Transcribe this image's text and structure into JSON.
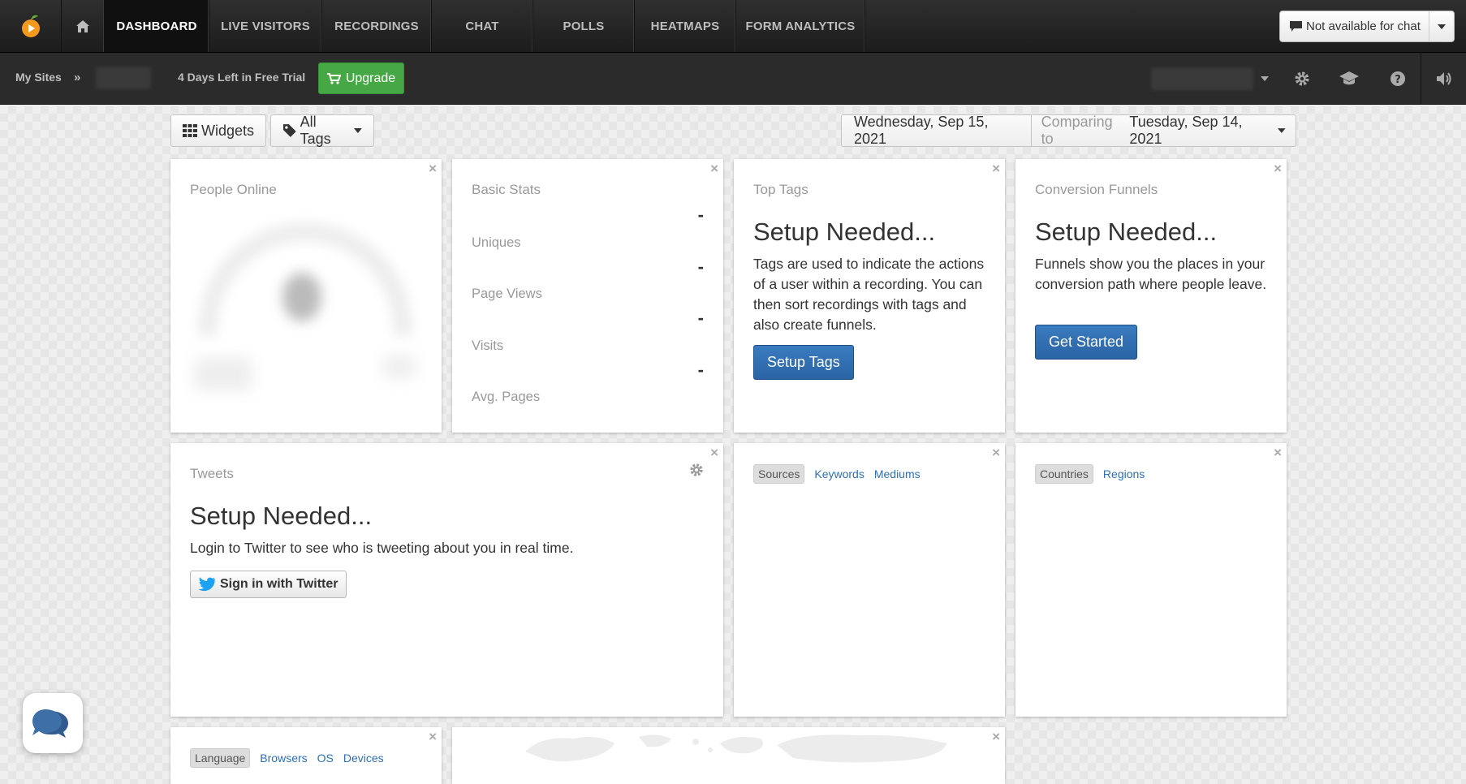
{
  "nav": {
    "items": [
      {
        "label": "DASHBOARD",
        "active": true
      },
      {
        "label": "LIVE VISITORS",
        "active": false
      },
      {
        "label": "RECORDINGS",
        "active": false
      },
      {
        "label": "CHAT",
        "active": false
      },
      {
        "label": "POLLS",
        "active": false
      },
      {
        "label": "HEATMAPS",
        "active": false
      },
      {
        "label": "FORM ANALYTICS",
        "active": false
      }
    ],
    "chat_status": "Not available for chat"
  },
  "subnav": {
    "my_sites": "My Sites",
    "separator": "»",
    "trial": "4 Days Left in Free Trial",
    "upgrade": "Upgrade"
  },
  "toolbar": {
    "widgets": "Widgets",
    "all_tags": "All Tags",
    "date": "Wednesday, Sep 15, 2021",
    "comparing_prefix": "Comparing to",
    "comparing_date": "Tuesday, Sep 14, 2021"
  },
  "widgets": {
    "close_glyph": "×",
    "people_online": {
      "title": "People Online"
    },
    "basic_stats": {
      "title": "Basic Stats",
      "stats": [
        {
          "label": "Uniques",
          "value": "-"
        },
        {
          "label": "Page Views",
          "value": "-"
        },
        {
          "label": "Visits",
          "value": "-"
        },
        {
          "label": "Avg. Pages",
          "value": "-"
        }
      ]
    },
    "top_tags": {
      "title": "Top Tags",
      "heading": "Setup Needed...",
      "desc": "Tags are used to indicate the actions of a user within a recording. You can then sort recordings with tags and also create funnels.",
      "button": "Setup Tags"
    },
    "conversion_funnels": {
      "title": "Conversion Funnels",
      "heading": "Setup Needed...",
      "desc": "Funnels show you the places in your conversion path where people leave.",
      "button": "Get Started"
    },
    "tweets": {
      "title": "Tweets",
      "heading": "Setup Needed...",
      "desc": "Login to Twitter to see who is tweeting about you in real time.",
      "button": "Sign in with Twitter"
    },
    "sources": {
      "tabs": [
        "Sources",
        "Keywords",
        "Mediums"
      ]
    },
    "countries": {
      "tabs": [
        "Countries",
        "Regions"
      ]
    },
    "language": {
      "tabs": [
        "Language",
        "Browsers",
        "OS",
        "Devices"
      ]
    }
  },
  "colors": {
    "accent_green": "#45a845",
    "button_blue": "#2a64a5",
    "link_blue": "#2f6fb0",
    "nav_dark": "#1c1c1c"
  }
}
